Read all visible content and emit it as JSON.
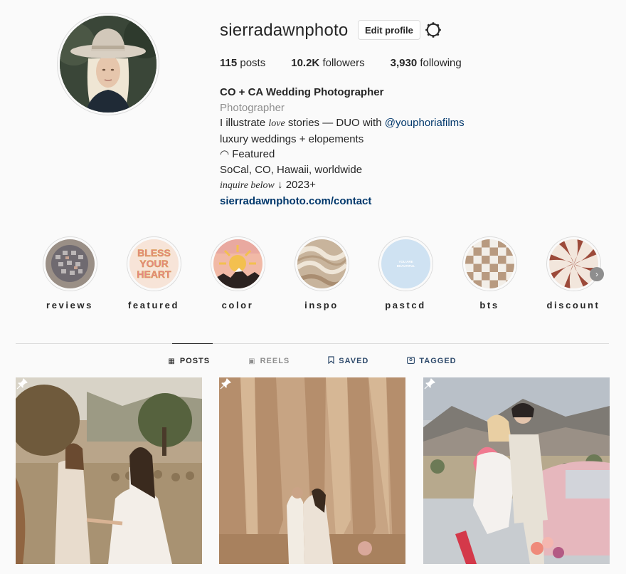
{
  "profile": {
    "username": "sierradawnphoto",
    "edit_label": "Edit profile",
    "stats": {
      "posts_count": "115",
      "posts_label": "posts",
      "followers_count": "10.2K",
      "followers_label": "followers",
      "following_count": "3,930",
      "following_label": "following"
    },
    "bio": {
      "name": "CO + CA Wedding Photographer",
      "category": "Photographer",
      "line1_pre": "I illustrate ",
      "line1_italic": "love",
      "line1_mid": " stories — DUO with ",
      "line1_mention": "@youphoriafilms",
      "line2": "luxury weddings + elopements",
      "line3": "◠ Featured",
      "line4": "SoCal, CO, Hawaii, worldwide",
      "line5_italic": "inquire below",
      "line5_rest": " ↓ 2023+",
      "link": "sierradawnphoto.com/contact"
    }
  },
  "highlights": [
    {
      "label": "reviews"
    },
    {
      "label": "featured",
      "art_text": "BLESS YOUR HEART"
    },
    {
      "label": "color"
    },
    {
      "label": "inspo"
    },
    {
      "label": "pastcd",
      "art_text": "YOU ARE BEAUTIFUL"
    },
    {
      "label": "bts"
    },
    {
      "label": "discount"
    }
  ],
  "tabs": [
    {
      "label": "POSTS",
      "icon": "grid-icon"
    },
    {
      "label": "REELS",
      "icon": "reels-icon"
    },
    {
      "label": "SAVED",
      "icon": "bookmark-icon"
    },
    {
      "label": "TAGGED",
      "icon": "tagged-icon"
    }
  ],
  "posts": [
    {
      "icon": "pin-icon"
    },
    {
      "icon": "pin-icon"
    },
    {
      "icon": "pin-icon"
    }
  ],
  "colors": {
    "link": "#00376b",
    "secondary_text": "#8e8e8e",
    "border": "#dbdbdb",
    "background": "#fafafa"
  }
}
